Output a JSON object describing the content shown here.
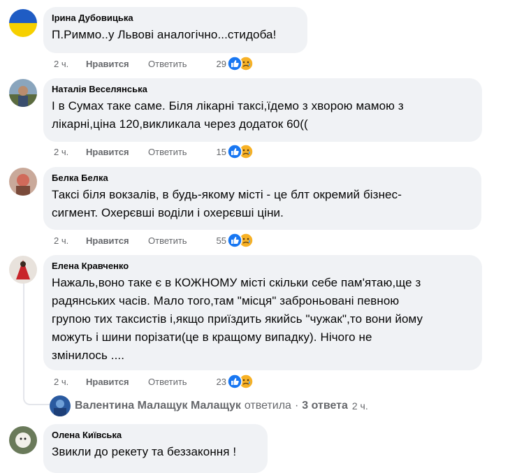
{
  "comments": [
    {
      "author": "Ірина Дубовицька",
      "text": "П.Риммо..у Львові аналогічно...стидоба!",
      "time": "2 ч.",
      "like_label": "Нравится",
      "reply_label": "Ответить",
      "reaction_count": "29",
      "avatar": "ukraine-flag-avatar"
    },
    {
      "author": "Наталія Веселянська",
      "text": "І в Сумах таке саме. Біля лікарні таксі,їдемо з хворою мамою з\nлікарні,ціна 120,викликала через додаток 60((",
      "time": "2 ч.",
      "like_label": "Нравится",
      "reply_label": "Ответить",
      "reaction_count": "15",
      "avatar": "photo-avatar"
    },
    {
      "author": "Белка Белка",
      "text": "Таксі біля вокзалів, в будь-якому місті - це блт окремий бізнес-\nсигмент. Охерєвші воділи і охерєвші ціни.",
      "time": "2 ч.",
      "like_label": "Нравится",
      "reply_label": "Ответить",
      "reaction_count": "55",
      "avatar": "photo-avatar"
    },
    {
      "author": "Елена Кравченко",
      "text": "Нажаль,воно таке є в КОЖНОМУ місті скільки себе пам'ятаю,ще з\nрадянських часів. Мало того,там \"місця\" заброньовані певною\nгрупою тих таксистів і,якщо приїздить якийсь \"чужак\",то вони йому\nможуть і шини порізати(це в кращому випадку). Нічого не\nзмінилось ....",
      "time": "2 ч.",
      "like_label": "Нравится",
      "reply_label": "Ответить",
      "reaction_count": "23",
      "avatar": "photo-avatar"
    },
    {
      "author": "Олена Київська",
      "text": "Звикли до рекету та беззаконня !",
      "avatar": "photo-avatar"
    }
  ],
  "replies_summary": {
    "author": "Валентина Малащук Малащук",
    "action": "ответила",
    "count": "3 ответа",
    "time": "2 ч."
  },
  "colors": {
    "bubble": "#f0f2f5",
    "secondary_text": "#65676b",
    "like_blue": "#1877f2",
    "care_yellow": "#f7b125"
  },
  "icons": [
    "like-reaction-icon",
    "care-reaction-icon"
  ]
}
